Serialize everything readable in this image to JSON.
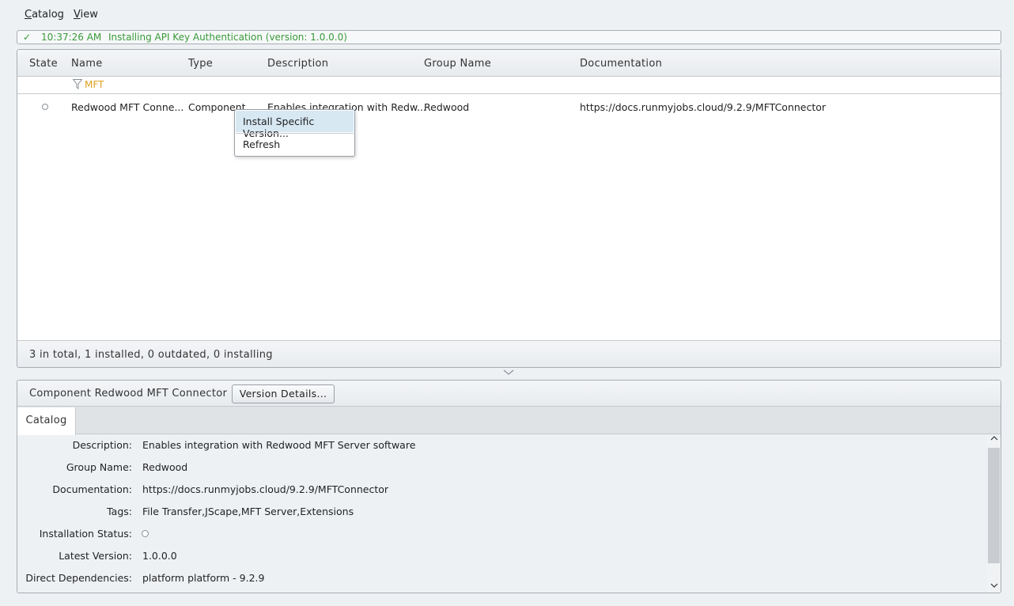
{
  "menu": {
    "items": [
      {
        "label": "Catalog",
        "accel": "C",
        "rest": "atalog"
      },
      {
        "label": "View",
        "accel": "V",
        "rest": "iew"
      }
    ]
  },
  "status": {
    "time": "10:37:26 AM",
    "message": "Installing API Key Authentication (version: 1.0.0.0)",
    "color": "#3a9a3a"
  },
  "table": {
    "columns": [
      "State",
      "Name",
      "Type",
      "Description",
      "Group Name",
      "Documentation"
    ],
    "filter": "MFT",
    "rows": [
      {
        "name": "Redwood MFT Conne...",
        "type": "Component",
        "description": "Enables integration with Redw...",
        "group": "Redwood",
        "documentation": "https://docs.runmyjobs.cloud/9.2.9/MFTConnector"
      }
    ],
    "summary": "3 in total, 1 installed, 0 outdated, 0 installing"
  },
  "context_menu": {
    "items": [
      "Install Specific Version...",
      "Refresh"
    ]
  },
  "details": {
    "title": "Component Redwood MFT Connector",
    "version_button": "Version Details...",
    "tab": "Catalog",
    "properties": [
      {
        "label": "Description:",
        "value": "Enables integration with Redwood MFT Server software"
      },
      {
        "label": "Group Name:",
        "value": "Redwood"
      },
      {
        "label": "Documentation:",
        "value": "https://docs.runmyjobs.cloud/9.2.9/MFTConnector"
      },
      {
        "label": "Tags:",
        "value": "File Transfer,JScape,MFT Server,Extensions"
      },
      {
        "label": "Installation Status:",
        "value": ""
      },
      {
        "label": "Latest Version:",
        "value": "1.0.0.0"
      },
      {
        "label": "Direct Dependencies:",
        "value": "platform platform - 9.2.9"
      }
    ]
  },
  "icons": {
    "check": "check-icon",
    "filter": "filter-icon",
    "chevron": "chevron-down-icon"
  }
}
